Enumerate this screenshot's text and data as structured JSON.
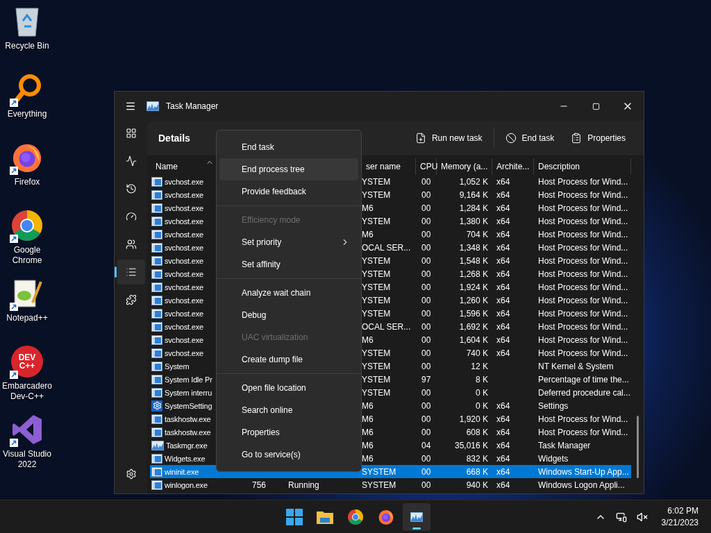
{
  "desktop_icons": [
    {
      "kind": "recycle",
      "label": "Recycle Bin",
      "shortcut": false
    },
    {
      "kind": "everything",
      "label": "Everything",
      "shortcut": true
    },
    {
      "kind": "firefox",
      "label": "Firefox",
      "shortcut": true
    },
    {
      "kind": "chrome",
      "label": "Google Chrome",
      "shortcut": true
    },
    {
      "kind": "notepad",
      "label": "Notepad++",
      "shortcut": true
    },
    {
      "kind": "devcpp",
      "label": "Embarcadero Dev-C++",
      "shortcut": true,
      "logo_lines": [
        "DEV",
        "C++"
      ]
    },
    {
      "kind": "vstudio",
      "label": "Visual Studio 2022",
      "shortcut": true
    }
  ],
  "window": {
    "title": "Task Manager",
    "nav": [
      {
        "kind": "processes",
        "selected": false
      },
      {
        "kind": "performance",
        "selected": false
      },
      {
        "kind": "history",
        "selected": false
      },
      {
        "kind": "startup",
        "selected": false
      },
      {
        "kind": "users",
        "selected": false
      },
      {
        "kind": "details",
        "selected": true
      },
      {
        "kind": "services",
        "selected": false
      }
    ],
    "page_title": "Details",
    "toolbar": [
      {
        "kind": "run",
        "label": "Run new task"
      },
      {
        "kind": "end",
        "label": "End task"
      },
      {
        "kind": "properties",
        "label": "Properties"
      }
    ],
    "table": {
      "columns": [
        {
          "kind": "name",
          "label": "Name",
          "sorted": true
        },
        {
          "kind": "user",
          "label": "ser name"
        },
        {
          "kind": "cpu",
          "label": "CPU"
        },
        {
          "kind": "memory",
          "label": "Memory (a..."
        },
        {
          "kind": "arch",
          "label": "Archite..."
        },
        {
          "kind": "description",
          "label": "Description"
        }
      ],
      "rows": [
        {
          "kind": "process",
          "name": "svchost.exe",
          "user": "YSTEM",
          "cpu": "00",
          "memory": "1,052 K",
          "arch": "x64",
          "description": "Host Process for Wind...",
          "selected": false
        },
        {
          "kind": "process",
          "name": "svchost.exe",
          "user": "YSTEM",
          "cpu": "00",
          "memory": "9,164 K",
          "arch": "x64",
          "description": "Host Process for Wind...",
          "selected": false
        },
        {
          "kind": "process",
          "name": "svchost.exe",
          "user": "M6",
          "cpu": "00",
          "memory": "1,284 K",
          "arch": "x64",
          "description": "Host Process for Wind...",
          "selected": false
        },
        {
          "kind": "process",
          "name": "svchost.exe",
          "user": "YSTEM",
          "cpu": "00",
          "memory": "1,380 K",
          "arch": "x64",
          "description": "Host Process for Wind...",
          "selected": false
        },
        {
          "kind": "process",
          "name": "svchost.exe",
          "user": "M6",
          "cpu": "00",
          "memory": "704 K",
          "arch": "x64",
          "description": "Host Process for Wind...",
          "selected": false
        },
        {
          "kind": "process",
          "name": "svchost.exe",
          "user": "OCAL SER...",
          "cpu": "00",
          "memory": "1,348 K",
          "arch": "x64",
          "description": "Host Process for Wind...",
          "selected": false
        },
        {
          "kind": "process",
          "name": "svchost.exe",
          "user": "YSTEM",
          "cpu": "00",
          "memory": "1,548 K",
          "arch": "x64",
          "description": "Host Process for Wind...",
          "selected": false
        },
        {
          "kind": "process",
          "name": "svchost.exe",
          "user": "YSTEM",
          "cpu": "00",
          "memory": "1,268 K",
          "arch": "x64",
          "description": "Host Process for Wind...",
          "selected": false
        },
        {
          "kind": "process",
          "name": "svchost.exe",
          "user": "YSTEM",
          "cpu": "00",
          "memory": "1,924 K",
          "arch": "x64",
          "description": "Host Process for Wind...",
          "selected": false
        },
        {
          "kind": "process",
          "name": "svchost.exe",
          "user": "YSTEM",
          "cpu": "00",
          "memory": "1,260 K",
          "arch": "x64",
          "description": "Host Process for Wind...",
          "selected": false
        },
        {
          "kind": "process",
          "name": "svchost.exe",
          "user": "YSTEM",
          "cpu": "00",
          "memory": "1,596 K",
          "arch": "x64",
          "description": "Host Process for Wind...",
          "selected": false
        },
        {
          "kind": "process",
          "name": "svchost.exe",
          "user": "OCAL SER...",
          "cpu": "00",
          "memory": "1,692 K",
          "arch": "x64",
          "description": "Host Process for Wind...",
          "selected": false
        },
        {
          "kind": "process",
          "name": "svchost.exe",
          "user": "M6",
          "cpu": "00",
          "memory": "1,604 K",
          "arch": "x64",
          "description": "Host Process for Wind...",
          "selected": false
        },
        {
          "kind": "process",
          "name": "svchost.exe",
          "user": "YSTEM",
          "cpu": "00",
          "memory": "740 K",
          "arch": "x64",
          "description": "Host Process for Wind...",
          "selected": false
        },
        {
          "kind": "process",
          "name": "System",
          "user": "YSTEM",
          "cpu": "00",
          "memory": "12 K",
          "description": "NT Kernel & System",
          "selected": false
        },
        {
          "kind": "process",
          "name": "System Idle Pr",
          "user": "YSTEM",
          "cpu": "97",
          "memory": "8 K",
          "description": "Percentage of time the...",
          "selected": false
        },
        {
          "kind": "process",
          "name": "System interru",
          "user": "YSTEM",
          "cpu": "00",
          "memory": "0 K",
          "description": "Deferred procedure cal...",
          "selected": false
        },
        {
          "kind": "settings",
          "name": "SystemSetting",
          "user": "M6",
          "cpu": "00",
          "memory": "0 K",
          "arch": "x64",
          "description": "Settings",
          "selected": false
        },
        {
          "kind": "process",
          "name": "taskhostw.exe",
          "user": "M6",
          "cpu": "00",
          "memory": "1,920 K",
          "arch": "x64",
          "description": "Host Process for Wind...",
          "selected": false
        },
        {
          "kind": "process",
          "name": "taskhostw.exe",
          "user": "M6",
          "cpu": "00",
          "memory": "608 K",
          "arch": "x64",
          "description": "Host Process for Wind...",
          "selected": false
        },
        {
          "kind": "taskmgr",
          "name": "Taskmgr.exe",
          "user": "M6",
          "cpu": "04",
          "memory": "35,016 K",
          "arch": "x64",
          "description": "Task Manager",
          "selected": false
        },
        {
          "kind": "process",
          "name": "Widgets.exe",
          "user": "M6",
          "cpu": "00",
          "memory": "832 K",
          "arch": "x64",
          "description": "Widgets",
          "selected": false
        },
        {
          "kind": "process",
          "name": "wininit.exe",
          "user": "SYSTEM",
          "cpu": "00",
          "memory": "668 K",
          "arch": "x64",
          "description": "Windows Start-Up App...",
          "selected": true
        },
        {
          "kind": "process",
          "name": "winlogon.exe",
          "pid": "756",
          "status": "Running",
          "user": "SYSTEM",
          "cpu": "00",
          "memory": "940 K",
          "arch": "x64",
          "description": "Windows Logon Appli...",
          "selected": false
        }
      ]
    }
  },
  "context_menu": {
    "items": [
      {
        "kind": "item",
        "label": "End task",
        "disabled": false,
        "hovered": false,
        "submenu": false
      },
      {
        "kind": "item",
        "label": "End process tree",
        "disabled": false,
        "hovered": true,
        "submenu": false
      },
      {
        "kind": "item",
        "label": "Provide feedback",
        "disabled": false,
        "hovered": false,
        "submenu": false
      },
      {
        "kind": "separator"
      },
      {
        "kind": "item",
        "label": "Efficiency mode",
        "disabled": true,
        "hovered": false,
        "submenu": false
      },
      {
        "kind": "item",
        "label": "Set priority",
        "disabled": false,
        "hovered": false,
        "submenu": true
      },
      {
        "kind": "item",
        "label": "Set affinity",
        "disabled": false,
        "hovered": false,
        "submenu": false
      },
      {
        "kind": "separator"
      },
      {
        "kind": "item",
        "label": "Analyze wait chain",
        "disabled": false,
        "hovered": false,
        "submenu": false
      },
      {
        "kind": "item",
        "label": "Debug",
        "disabled": false,
        "hovered": false,
        "submenu": false
      },
      {
        "kind": "item",
        "label": "UAC virtualization",
        "disabled": true,
        "hovered": false,
        "submenu": false
      },
      {
        "kind": "item",
        "label": "Create dump file",
        "disabled": false,
        "hovered": false,
        "submenu": false
      },
      {
        "kind": "separator"
      },
      {
        "kind": "item",
        "label": "Open file location",
        "disabled": false,
        "hovered": false,
        "submenu": false
      },
      {
        "kind": "item",
        "label": "Search online",
        "disabled": false,
        "hovered": false,
        "submenu": false
      },
      {
        "kind": "item",
        "label": "Properties",
        "disabled": false,
        "hovered": false,
        "submenu": false
      },
      {
        "kind": "item",
        "label": "Go to service(s)",
        "disabled": false,
        "hovered": false,
        "submenu": false
      }
    ]
  },
  "taskbar": {
    "apps": [
      {
        "kind": "start",
        "active": false
      },
      {
        "kind": "explorer",
        "active": false
      },
      {
        "kind": "chrome",
        "active": false
      },
      {
        "kind": "firefox",
        "active": false
      },
      {
        "kind": "taskmgr",
        "active": true
      }
    ],
    "time": "6:02 PM",
    "date": "3/21/2023"
  }
}
